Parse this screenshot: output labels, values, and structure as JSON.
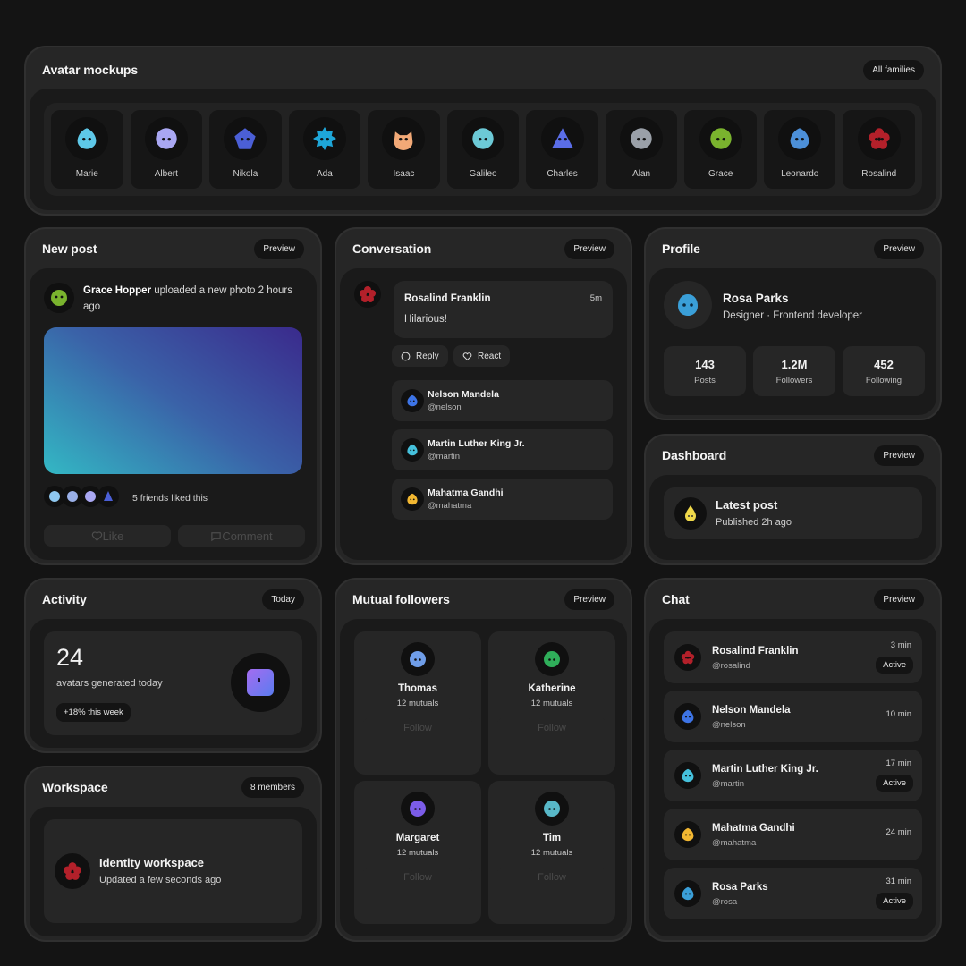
{
  "avatar_mockups": {
    "title": "Avatar mockups",
    "pill": "All families",
    "avatars": [
      {
        "name": "Marie",
        "color": "#5ec8e8",
        "icon": "drop-face-icon"
      },
      {
        "name": "Albert",
        "color": "#a9a7f2",
        "icon": "blob-face-icon"
      },
      {
        "name": "Nikola",
        "color": "#4b5fd6",
        "icon": "pentagon-face-icon"
      },
      {
        "name": "Ada",
        "color": "#1ea6d8",
        "icon": "gear-face-icon"
      },
      {
        "name": "Isaac",
        "color": "#f2a977",
        "icon": "cat-face-icon"
      },
      {
        "name": "Galileo",
        "color": "#6cc9d6",
        "icon": "crystal-face-icon"
      },
      {
        "name": "Charles",
        "color": "#5a6de8",
        "icon": "triangle-face-icon"
      },
      {
        "name": "Alan",
        "color": "#9aa0a8",
        "icon": "rock-face-icon"
      },
      {
        "name": "Grace",
        "color": "#7ab32e",
        "icon": "ball-face-icon"
      },
      {
        "name": "Leonardo",
        "color": "#4c8fd8",
        "icon": "drop-face-icon"
      },
      {
        "name": "Rosalind",
        "color": "#b3202a",
        "icon": "flower-face-icon"
      }
    ]
  },
  "new_post": {
    "title": "New post",
    "pill": "Preview",
    "author": "Grace Hopper",
    "text": " uploaded a new photo 2 hours ago",
    "likes_text": "5 friends liked this",
    "like_label": "Like",
    "comment_label": "Comment",
    "gradient": [
      "#33b8c4",
      "#3a2a8c"
    ]
  },
  "conversation": {
    "title": "Conversation",
    "pill": "Preview",
    "message": {
      "name": "Rosalind Franklin",
      "time": "5m",
      "text": "Hilarious!"
    },
    "reply_label": "Reply",
    "react_label": "React",
    "people": [
      {
        "name": "Nelson Mandela",
        "handle": "@nelson",
        "color": "#3d74e6"
      },
      {
        "name": "Martin Luther King Jr.",
        "handle": "@martin",
        "color": "#45c1dc"
      },
      {
        "name": "Mahatma Gandhi",
        "handle": "@mahatma",
        "color": "#f2b731"
      }
    ]
  },
  "profile": {
    "title": "Profile",
    "pill": "Preview",
    "name": "Rosa Parks",
    "role": "Designer · Frontend developer",
    "stats": [
      {
        "value": "143",
        "label": "Posts"
      },
      {
        "value": "1.2M",
        "label": "Followers"
      },
      {
        "value": "452",
        "label": "Following"
      }
    ]
  },
  "dashboard": {
    "title": "Dashboard",
    "pill": "Preview",
    "headline": "Latest post",
    "sub": "Published 2h ago"
  },
  "activity": {
    "title": "Activity",
    "pill": "Today",
    "value": "24",
    "label": "avatars generated today",
    "trend": "+18% this week"
  },
  "workspace": {
    "title": "Workspace",
    "pill": "8 members",
    "name": "Identity workspace",
    "sub": "Updated a few seconds ago"
  },
  "mutual_followers": {
    "title": "Mutual followers",
    "pill": "Preview",
    "follow_label": "Follow",
    "people": [
      {
        "name": "Thomas",
        "mutuals": "12 mutuals",
        "color": "#6f9de8"
      },
      {
        "name": "Katherine",
        "mutuals": "12 mutuals",
        "color": "#2fae5a"
      },
      {
        "name": "Margaret",
        "mutuals": "12 mutuals",
        "color": "#7b5ce8"
      },
      {
        "name": "Tim",
        "mutuals": "12 mutuals",
        "color": "#58b8c8"
      }
    ]
  },
  "chat": {
    "title": "Chat",
    "pill": "Preview",
    "rows": [
      {
        "name": "Rosalind Franklin",
        "handle": "@rosalind",
        "time": "3 min",
        "status": "Active",
        "color": "#b3202a"
      },
      {
        "name": "Nelson Mandela",
        "handle": "@nelson",
        "time": "10 min",
        "status": "",
        "color": "#3d74e6"
      },
      {
        "name": "Martin Luther King Jr.",
        "handle": "@martin",
        "time": "17 min",
        "status": "Active",
        "color": "#45c1dc"
      },
      {
        "name": "Mahatma Gandhi",
        "handle": "@mahatma",
        "time": "24 min",
        "status": "",
        "color": "#f2b731"
      },
      {
        "name": "Rosa Parks",
        "handle": "@rosa",
        "time": "31 min",
        "status": "Active",
        "color": "#3a9fd8"
      }
    ]
  }
}
